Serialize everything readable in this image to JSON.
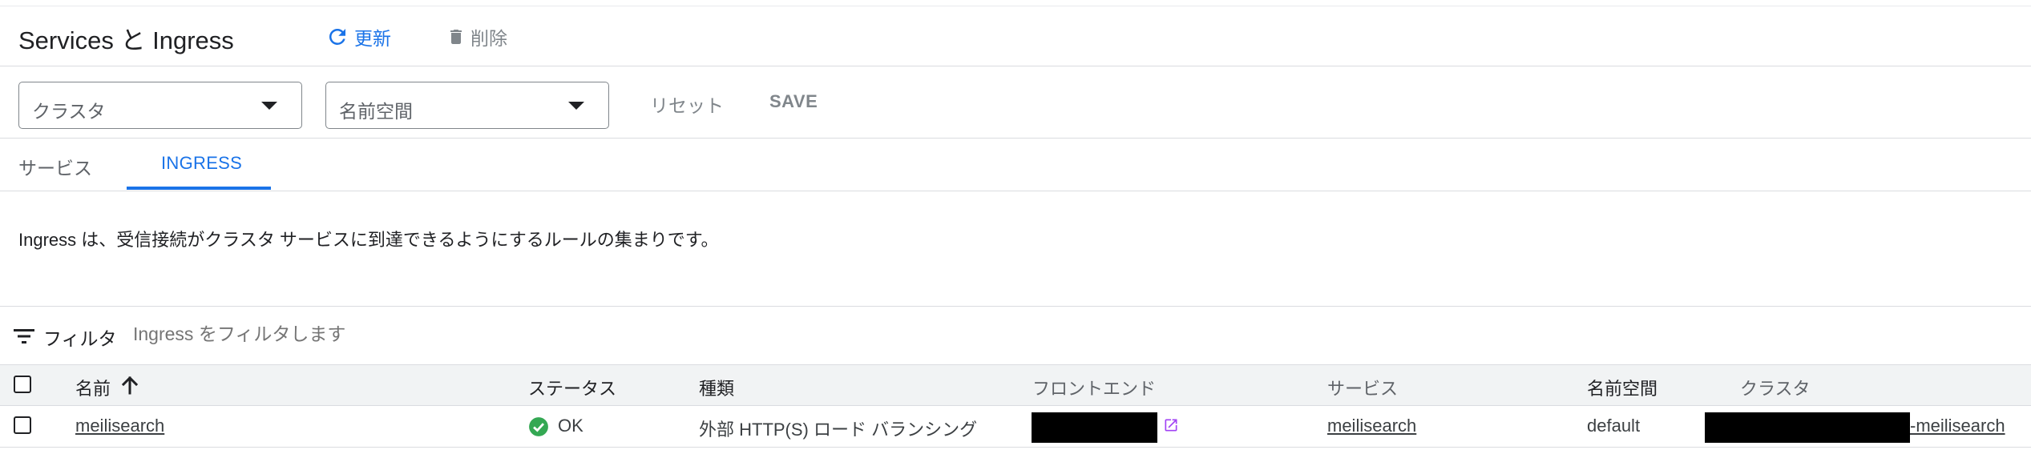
{
  "header": {
    "title": "Services と Ingress",
    "refresh_label": "更新",
    "delete_label": "削除"
  },
  "filters": {
    "cluster_label": "クラスタ",
    "namespace_label": "名前空間",
    "reset_label": "リセット",
    "save_label": "SAVE"
  },
  "tabs": [
    {
      "label": "サービス",
      "active": false
    },
    {
      "label": "INGRESS",
      "active": true
    }
  ],
  "description": "Ingress は、受信接続がクラスタ サービスに到達できるようにするルールの集まりです。",
  "filterbar": {
    "label": "フィルタ",
    "placeholder": "Ingress をフィルタします"
  },
  "table": {
    "columns": [
      "名前",
      "ステータス",
      "種類",
      "フロントエンド",
      "サービス",
      "名前空間",
      "クラスタ"
    ],
    "rows": [
      {
        "name": "meilisearch",
        "status": "OK",
        "type": "外部 HTTP(S) ロード バランシング",
        "service": "meilisearch",
        "namespace": "default",
        "cluster_suffix": "-meilisearch"
      }
    ]
  },
  "colors": {
    "accent": "#1a73e8",
    "ok": "#34a853",
    "external_link": "#a142f4"
  },
  "icons": [
    "refresh-icon",
    "trash-icon",
    "chevron-down-icon",
    "filter-icon",
    "arrow-up-icon",
    "check-circle-icon",
    "external-link-icon"
  ]
}
